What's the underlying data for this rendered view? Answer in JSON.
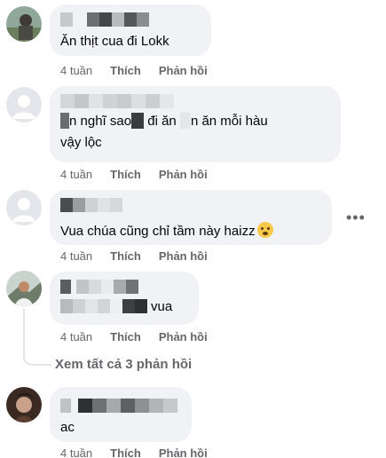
{
  "comments": [
    {
      "text": "Ăn thịt cua đi Lokk",
      "time": "4 tuần",
      "like": "Thích",
      "reply": "Phản hồi"
    },
    {
      "text_line1": "n nghĩ sao",
      "text_line1b": "đi ăn",
      "text_line1c": "n ăn mỗi hàu",
      "text_line2": "vậy lộc",
      "time": "4 tuần",
      "like": "Thích",
      "reply": "Phản hồi"
    },
    {
      "text": "Vua chúa cũng chỉ tầm này haizz",
      "time": "4 tuần",
      "like": "Thích",
      "reply": "Phản hồi"
    },
    {
      "text": "vua",
      "time": "4 tuần",
      "like": "Thích",
      "reply": "Phản hồi"
    },
    {
      "text": "ac",
      "time": "4 tuần",
      "like": "Thích",
      "reply": "Phản hồi"
    }
  ],
  "view_replies": "Xem tất cả 3 phản hồi",
  "more_options_glyph": "•••",
  "colors": {
    "bubble": "#f0f2f5",
    "meta": "#65676b",
    "text": "#050505"
  }
}
